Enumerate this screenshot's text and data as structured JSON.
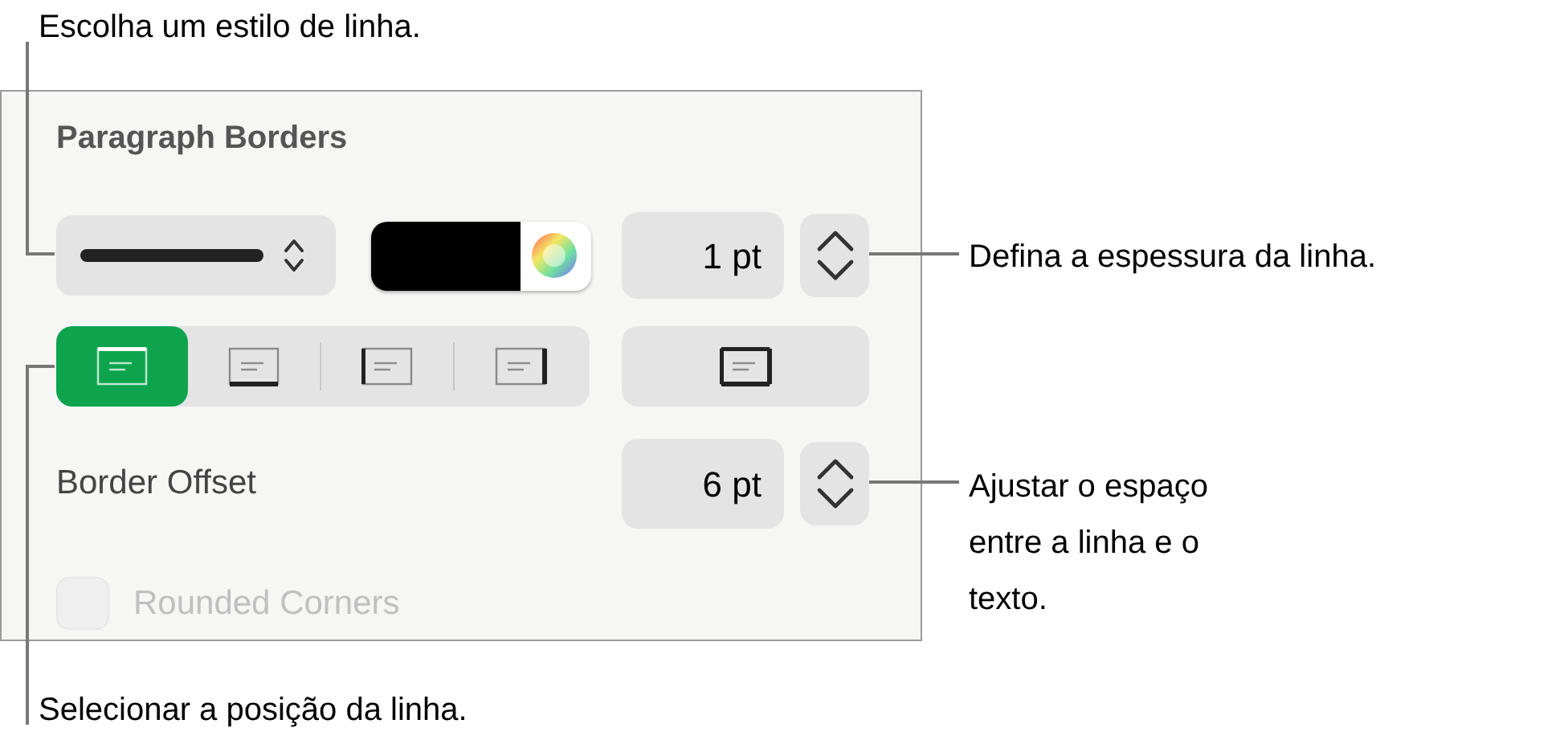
{
  "callouts": {
    "line_style": "Escolha um estilo de linha.",
    "thickness": "Defina a espessura da linha.",
    "offset": "Ajustar o espaço entre a linha e o texto.",
    "position": "Selecionar a posição da linha."
  },
  "panel": {
    "title": "Paragraph Borders",
    "width_field": "1 pt",
    "positions": [
      {
        "kind": "top",
        "selected": true
      },
      {
        "kind": "bottom",
        "selected": false
      },
      {
        "kind": "left",
        "selected": false
      },
      {
        "kind": "right",
        "selected": false
      }
    ],
    "all_borders": {
      "kind": "all",
      "selected": false
    },
    "offset_label": "Border Offset",
    "offset_field": "6 pt",
    "rounded": {
      "label": "Rounded Corners",
      "checked": false,
      "disabled": true
    }
  }
}
